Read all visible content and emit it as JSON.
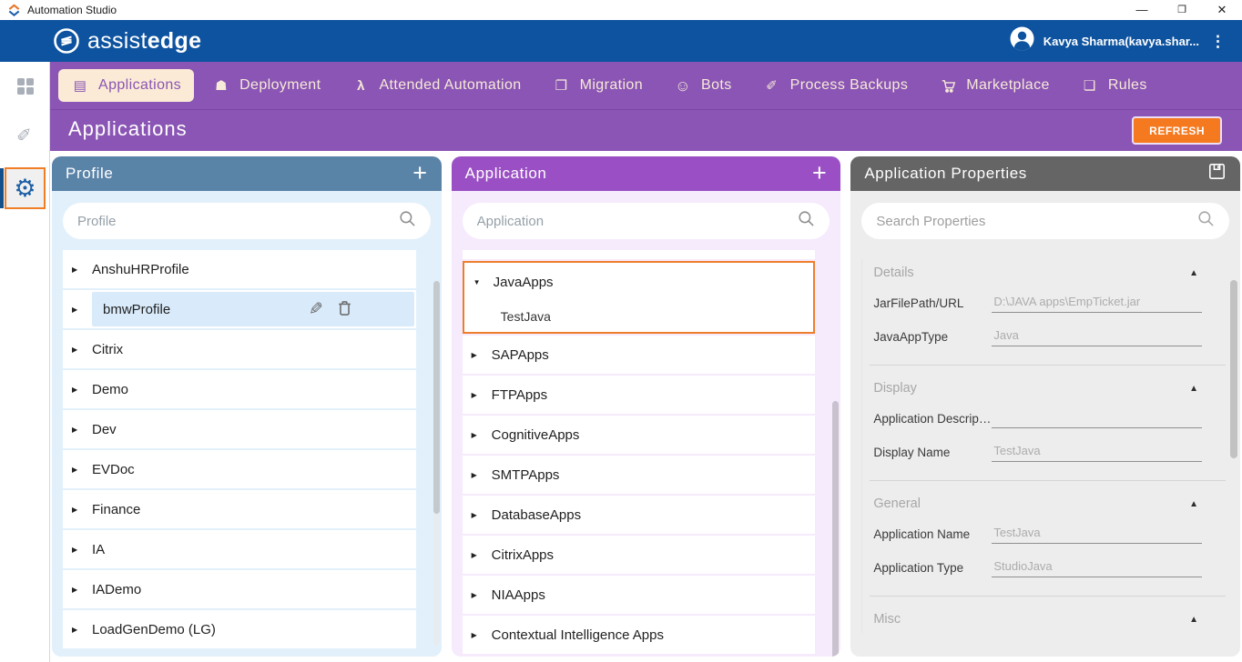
{
  "window": {
    "title": "Automation Studio"
  },
  "appbar": {
    "logo_light": "assist",
    "logo_bold": "edge",
    "user_name": "Kavya Sharma(kavya.shar..."
  },
  "nav": {
    "tabs": [
      {
        "label": "Applications",
        "icon": "applications-icon",
        "active": true
      },
      {
        "label": "Deployment",
        "icon": "deployment-icon",
        "active": false
      },
      {
        "label": "Attended Automation",
        "icon": "attended-automation-icon",
        "active": false
      },
      {
        "label": "Migration",
        "icon": "migration-icon",
        "active": false
      },
      {
        "label": "Bots",
        "icon": "bots-icon",
        "active": false
      },
      {
        "label": "Process Backups",
        "icon": "process-backups-icon",
        "active": false
      },
      {
        "label": "Marketplace",
        "icon": "marketplace-icon",
        "active": false
      },
      {
        "label": "Rules",
        "icon": "rules-icon",
        "active": false
      }
    ]
  },
  "page": {
    "title": "Applications",
    "refresh_button": "REFRESH"
  },
  "profile_panel": {
    "title": "Profile",
    "search_placeholder": "Profile",
    "items": [
      {
        "label": "AnshuHRProfile",
        "selected": false
      },
      {
        "label": "bmwProfile",
        "selected": true
      },
      {
        "label": "Citrix",
        "selected": false
      },
      {
        "label": "Demo",
        "selected": false
      },
      {
        "label": "Dev",
        "selected": false
      },
      {
        "label": "EVDoc",
        "selected": false
      },
      {
        "label": "Finance",
        "selected": false
      },
      {
        "label": "IA",
        "selected": false
      },
      {
        "label": "IADemo",
        "selected": false
      },
      {
        "label": "LoadGenDemo (LG)",
        "selected": false
      }
    ]
  },
  "application_panel": {
    "title": "Application",
    "search_placeholder": "Application",
    "expanded_group": {
      "label": "JavaApps",
      "child": "TestJava",
      "selected": true
    },
    "items": [
      {
        "label": "SAPApps"
      },
      {
        "label": "FTPApps"
      },
      {
        "label": "CognitiveApps"
      },
      {
        "label": "SMTPApps"
      },
      {
        "label": "DatabaseApps"
      },
      {
        "label": "CitrixApps"
      },
      {
        "label": "NIAApps"
      },
      {
        "label": "Contextual Intelligence Apps"
      }
    ]
  },
  "properties_panel": {
    "title": "Application Properties",
    "search_placeholder": "Search Properties",
    "sections": [
      {
        "title": "Details",
        "fields": [
          {
            "label": "JarFilePath/URL",
            "value": "D:\\JAVA apps\\EmpTicket.jar"
          },
          {
            "label": "JavaAppType",
            "value": "Java"
          }
        ]
      },
      {
        "title": "Display",
        "fields": [
          {
            "label": "Application Descripti...",
            "value": ""
          },
          {
            "label": "Display Name",
            "value": "TestJava"
          }
        ]
      },
      {
        "title": "General",
        "fields": [
          {
            "label": "Application Name",
            "value": "TestJava"
          },
          {
            "label": "Application Type",
            "value": "StudioJava"
          }
        ]
      },
      {
        "title": "Misc",
        "fields": []
      }
    ]
  },
  "colors": {
    "appbar_blue": "#0E539F",
    "nav_purple": "#8A55B4",
    "active_tab_bg": "#FBEBD6",
    "refresh_orange": "#F5791F",
    "profile_header_blue": "#5A83A8",
    "profile_body_blue": "#E2F0FB",
    "application_header_purple": "#9A50C4",
    "application_body_lavender": "#F6EAFD",
    "properties_header_gray": "#656565",
    "properties_body_gray": "#EDEDED",
    "selection_border_orange": "#EE7E2B",
    "selected_row_blue": "#D9EBFB"
  }
}
